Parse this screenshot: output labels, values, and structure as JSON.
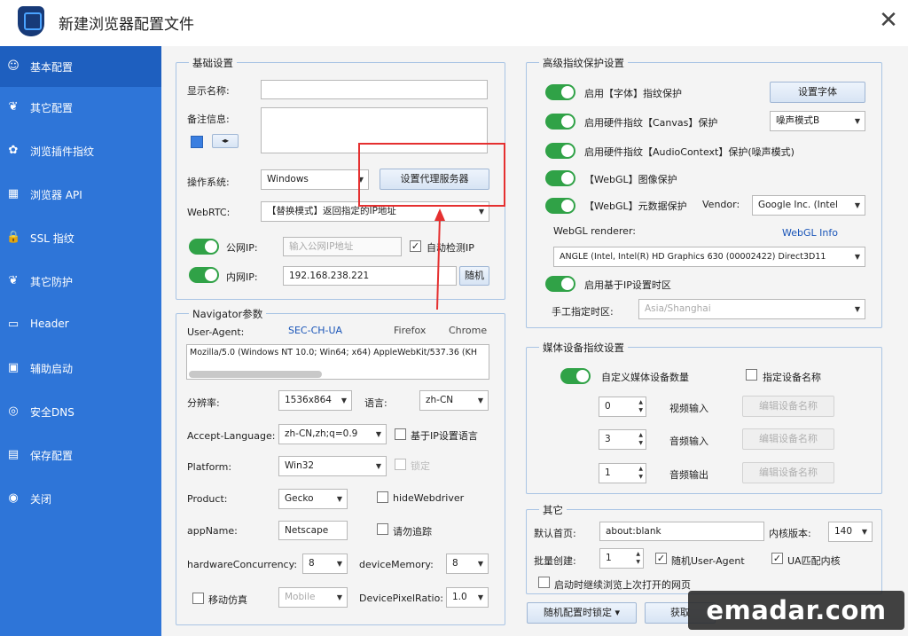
{
  "window": {
    "title": "新建浏览器配置文件",
    "close": "✕"
  },
  "sidebar": {
    "items": [
      {
        "label": "基本配置",
        "icon": "☺"
      },
      {
        "label": "其它配置",
        "icon": "❦"
      },
      {
        "label": "浏览插件指纹",
        "icon": "✿"
      },
      {
        "label": "浏览器 API",
        "icon": "▦"
      },
      {
        "label": "SSL 指纹",
        "icon": "🔒"
      },
      {
        "label": "其它防护",
        "icon": "❦"
      },
      {
        "label": "Header",
        "icon": "▭"
      },
      {
        "label": "辅助启动",
        "icon": "▣"
      },
      {
        "label": "安全DNS",
        "icon": "◎"
      },
      {
        "label": "保存配置",
        "icon": "▤"
      },
      {
        "label": "关闭",
        "icon": "◉"
      }
    ]
  },
  "basic": {
    "title": "基础设置",
    "display_name_label": "显示名称:",
    "display_name_value": "",
    "remark_label": "备注信息:",
    "os_label": "操作系统:",
    "os_value": "Windows",
    "proxy_button": "设置代理服务器",
    "webrtc_label": "WebRTC:",
    "webrtc_value": "【替换模式】返回指定的IP地址",
    "public_ip_label": "公网IP:",
    "public_ip_placeholder": "输入公网IP地址",
    "auto_detect_label": "自动检测IP",
    "lan_ip_label": "内网IP:",
    "lan_ip_value": "192.168.238.221",
    "random_button": "随机"
  },
  "navigator": {
    "title": "Navigator参数",
    "ua_label": "User-Agent:",
    "sec_ch_ua": "SEC-CH-UA",
    "firefox": "Firefox",
    "chrome": "Chrome",
    "ua_value": "Mozilla/5.0 (Windows NT 10.0; Win64; x64) AppleWebKit/537.36 (KH",
    "resolution_label": "分辨率:",
    "resolution_value": "1536x864",
    "language_label": "语言:",
    "language_value": "zh-CN",
    "accept_language_label": "Accept-Language:",
    "accept_language_value": "zh-CN,zh;q=0.9",
    "ip_language_label": "基于IP设置语言",
    "platform_label": "Platform:",
    "platform_value": "Win32",
    "platform_check_label": "锁定",
    "product_label": "Product:",
    "product_value": "Gecko",
    "hide_webdriver_label": "hideWebdriver",
    "appname_label": "appName:",
    "appname_value": "Netscape",
    "dnt_label": "请勿追踪",
    "hw_label": "hardwareConcurrency:",
    "hw_value": "8",
    "memory_label": "deviceMemory:",
    "memory_value": "8",
    "mobile_label": "移动仿真",
    "mobile_value": "Mobile",
    "dpr_label": "DevicePixelRatio:",
    "dpr_value": "1.0"
  },
  "fingerprint": {
    "title": "高级指纹保护设置",
    "font_label": "启用【字体】指纹保护",
    "font_button": "设置字体",
    "canvas_label": "启用硬件指纹【Canvas】保护",
    "canvas_mode": "噪声模式B",
    "audio_label": "启用硬件指纹【AudioContext】保护(噪声模式)",
    "webgl_image_label": "【WebGL】图像保护",
    "webgl_meta_label": "【WebGL】元数据保护",
    "vendor_label": "Vendor:",
    "vendor_value": "Google Inc. (Intel",
    "renderer_label": "WebGL renderer:",
    "webgl_info": "WebGL Info",
    "renderer_value": "ANGLE (Intel, Intel(R) HD Graphics 630 (00002422) Direct3D11",
    "timezone_label": "启用基于IP设置时区",
    "manual_tz_label": "手工指定时区:",
    "manual_tz_value": "Asia/Shanghai"
  },
  "media": {
    "title": "媒体设备指纹设置",
    "custom_label": "自定义媒体设备数量",
    "specify_name_label": "指定设备名称",
    "video_in_value": "0",
    "video_in_label": "视频输入",
    "audio_in_value": "3",
    "audio_in_label": "音频输入",
    "audio_out_value": "1",
    "audio_out_label": "音频输出",
    "edit_button": "编辑设备名称"
  },
  "other": {
    "title": "其它",
    "homepage_label": "默认首页:",
    "homepage_value": "about:blank",
    "kernel_label": "内核版本:",
    "kernel_value": "140",
    "batch_label": "批量创建:",
    "batch_value": "1",
    "random_ua_label": "随机User-Agent",
    "ua_match_label": "UA匹配内核",
    "continue_label": "启动时继续浏览上次打开的网页"
  },
  "footer": {
    "random_lock": "随机配置时锁定",
    "get_button": "获取"
  },
  "watermark": "emadar.com"
}
